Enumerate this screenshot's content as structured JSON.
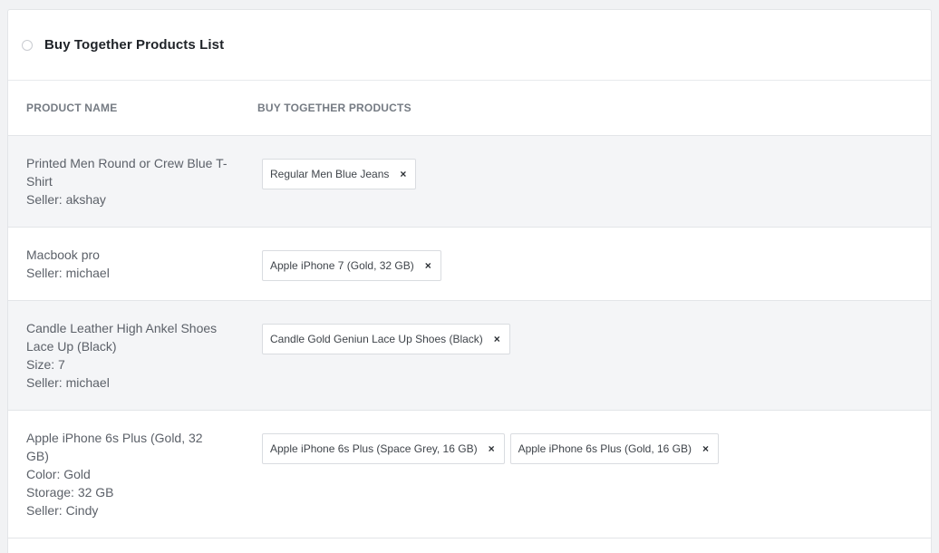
{
  "panel": {
    "title": "Buy Together Products List"
  },
  "table": {
    "headers": {
      "product_name": "PRODUCT NAME",
      "buy_together": "BUY TOGETHER PRODUCTS"
    },
    "rows": [
      {
        "product_lines": [
          "Printed Men Round or Crew Blue T-",
          "Shirt",
          "Seller: akshay"
        ],
        "chips": [
          "Regular Men Blue Jeans"
        ]
      },
      {
        "product_lines": [
          "Macbook pro",
          "Seller: michael"
        ],
        "chips": [
          "Apple iPhone 7 (Gold, 32 GB)"
        ]
      },
      {
        "product_lines": [
          "Candle Leather High Ankel Shoes",
          "Lace Up (Black)",
          "Size: 7",
          "Seller: michael"
        ],
        "chips": [
          "Candle Gold Geniun Lace Up Shoes (Black)"
        ]
      },
      {
        "product_lines": [
          "Apple iPhone 6s Plus (Gold, 32",
          "GB)",
          "Color: Gold",
          "Storage: 32 GB",
          "Seller: Cindy"
        ],
        "chips": [
          "Apple iPhone 6s Plus (Space Grey, 16 GB)",
          "Apple iPhone 6s Plus (Gold, 16 GB)"
        ]
      }
    ]
  },
  "icons": {
    "remove": "×"
  }
}
